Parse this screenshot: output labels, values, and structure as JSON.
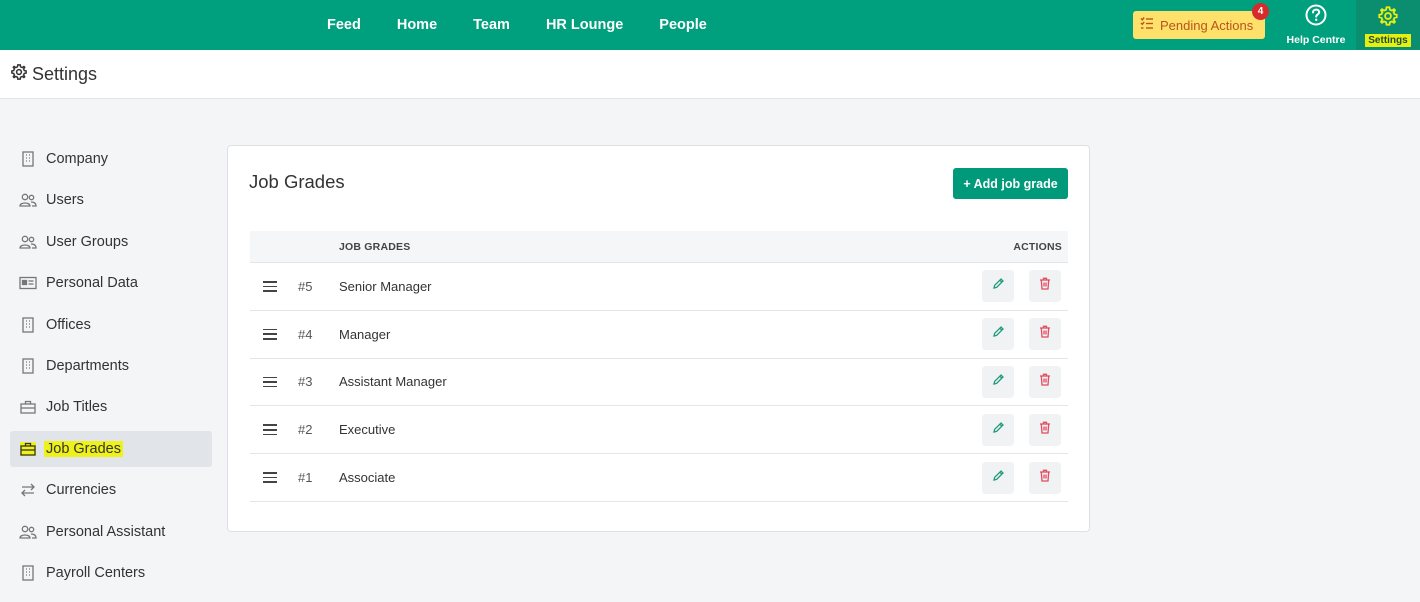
{
  "topbar": {
    "nav": [
      "Feed",
      "Home",
      "Team",
      "HR Lounge",
      "People"
    ],
    "pending_label": "Pending Actions",
    "pending_count": "4",
    "help_label": "Help Centre",
    "settings_label": "Settings",
    "color_bg": "#00a07e"
  },
  "page": {
    "title": "Settings"
  },
  "sidebar": {
    "items": [
      {
        "label": "Company",
        "icon": "building-icon"
      },
      {
        "label": "Users",
        "icon": "users-icon"
      },
      {
        "label": "User Groups",
        "icon": "users-icon"
      },
      {
        "label": "Personal Data",
        "icon": "id-card-icon"
      },
      {
        "label": "Offices",
        "icon": "building-icon"
      },
      {
        "label": "Departments",
        "icon": "building-icon"
      },
      {
        "label": "Job Titles",
        "icon": "briefcase-icon"
      },
      {
        "label": "Job Grades",
        "icon": "briefcase-icon"
      },
      {
        "label": "Currencies",
        "icon": "exchange-icon"
      },
      {
        "label": "Personal Assistant",
        "icon": "users-icon"
      },
      {
        "label": "Payroll Centers",
        "icon": "building-icon"
      }
    ],
    "active": "Job Grades"
  },
  "card": {
    "title": "Job Grades",
    "add_button": "+ Add job grade",
    "col_name": "JOB GRADES",
    "col_actions": "ACTIONS",
    "rows": [
      {
        "num": "#5",
        "name": "Senior Manager"
      },
      {
        "num": "#4",
        "name": "Manager"
      },
      {
        "num": "#3",
        "name": "Assistant Manager"
      },
      {
        "num": "#2",
        "name": "Executive"
      },
      {
        "num": "#1",
        "name": "Associate"
      }
    ]
  }
}
